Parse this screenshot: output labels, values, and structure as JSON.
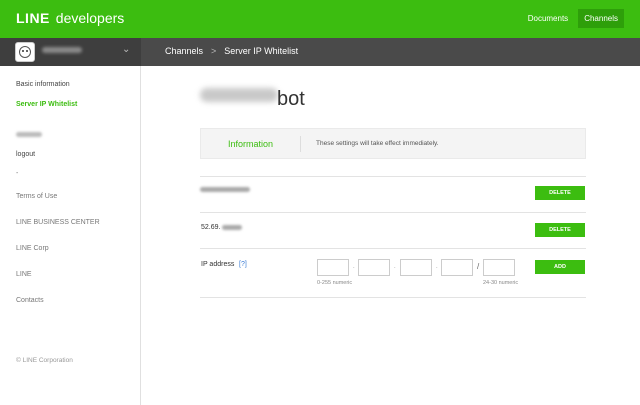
{
  "header": {
    "brand_line": "LINE",
    "brand_dev": "developers",
    "nav": [
      {
        "label": "Documents",
        "active": false
      },
      {
        "label": "Channels",
        "active": true
      }
    ]
  },
  "breadcrumb": {
    "items": [
      "Channels",
      "Server IP Whitelist"
    ],
    "separator": ">"
  },
  "sidebar": {
    "items": [
      {
        "label": "Basic information",
        "active": false
      },
      {
        "label": "Server IP Whitelist",
        "active": true
      },
      {
        "label": "logout"
      },
      {
        "label": "-"
      },
      {
        "label": "Terms of Use"
      },
      {
        "label": "LINE BUSINESS CENTER"
      },
      {
        "label": "LINE Corp"
      },
      {
        "label": "LINE"
      },
      {
        "label": "Contacts"
      }
    ],
    "footer": "© LINE Corporation"
  },
  "main": {
    "title_suffix": "bot",
    "info": {
      "label": "Information",
      "note": "These settings will take effect immediately."
    },
    "ip_rows": [
      {
        "ip_visible": "",
        "delete_label": "DELETE"
      },
      {
        "ip_visible": "52.69.",
        "delete_label": "DELETE"
      }
    ],
    "ip_form": {
      "label": "IP address",
      "help": "[?]",
      "octet_hint": "0-255 numeric",
      "cidr_hint": "24-30 numeric",
      "slash": "/",
      "add_label": "ADD"
    }
  },
  "colors": {
    "brand_green": "#3cbd10",
    "dark_bar": "#4a4a4a"
  }
}
